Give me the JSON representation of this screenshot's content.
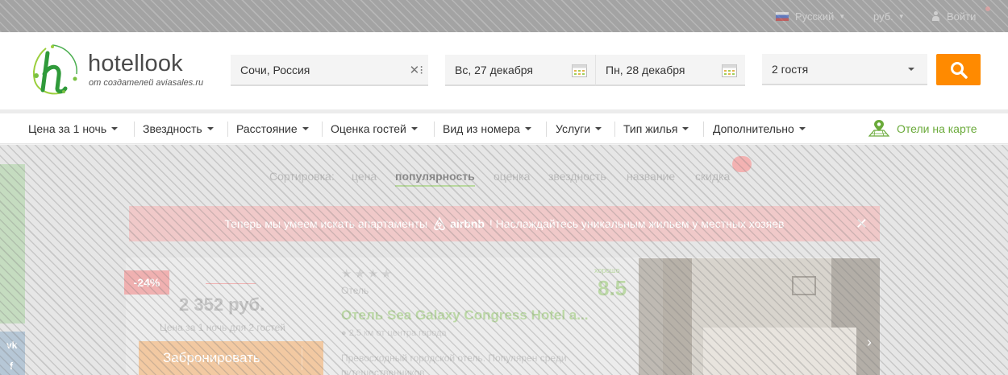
{
  "topbar": {
    "language": "Русский",
    "currency": "руб.",
    "login": "Войти"
  },
  "header": {
    "brand": "hotellook",
    "tagline": "от создателей aviasales.ru",
    "city_value": "Сочи, Россия",
    "checkin_value": "Вс, 27 декабря",
    "checkout_value": "Пн, 28 декабря",
    "guests_value": "2 гостя"
  },
  "filters": {
    "items": [
      {
        "label": "Цена за 1 ночь"
      },
      {
        "label": "Звездность"
      },
      {
        "label": "Расстояние"
      },
      {
        "label": "Оценка гостей"
      },
      {
        "label": "Вид из номера"
      },
      {
        "label": "Услуги"
      },
      {
        "label": "Тип жилья"
      },
      {
        "label": "Дополнительно"
      }
    ],
    "map_link": "Отели на карте"
  },
  "sort": {
    "label": "Сортировка:",
    "options": [
      "цена",
      "популярность",
      "оценка",
      "звездность",
      "название",
      "скидка"
    ],
    "active": "популярность"
  },
  "promo": {
    "text_before": "Теперь мы умеем искать апартаменты",
    "brand": "airbnb",
    "text_after": "! Наслаждайтесь уникальным жильем у местных хозяев"
  },
  "hotel": {
    "discount": "-24%",
    "price": "2 352 руб.",
    "price_note": "Цена за 1 ночь для 2 гостей",
    "book_label": "Забронировать",
    "stars": "★★★★",
    "type": "Отель",
    "name": "Отель Sea Galaxy Congress Hotel a...",
    "location": "2.5 км от центра города",
    "description": "Превосходный городской отель. Популярен среди путешественников",
    "rating_label": "хорошо",
    "rating": "8.5"
  },
  "colors": {
    "accent_orange": "#ff8a00",
    "accent_green": "#6aaa3a"
  }
}
